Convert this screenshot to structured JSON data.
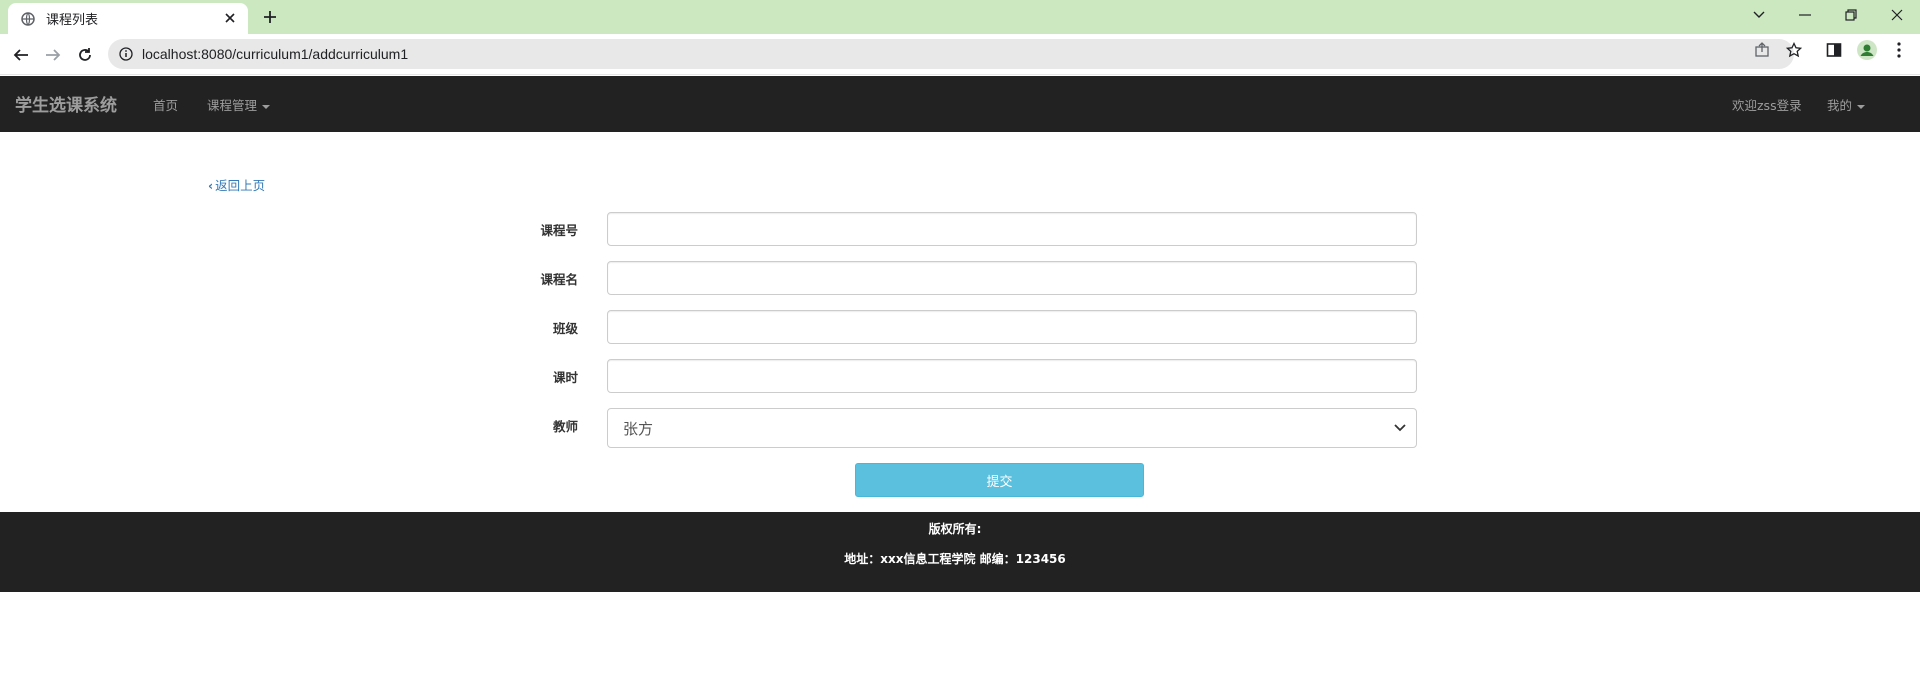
{
  "browser": {
    "tab_title": "课程列表",
    "url": "localhost:8080/curriculum1/addcurriculum1"
  },
  "navbar": {
    "brand": "学生选课系统",
    "home": "首页",
    "course_mgmt": "课程管理",
    "welcome": "欢迎zss登录",
    "mine": "我的"
  },
  "form": {
    "back_link": "返回上页",
    "course_no_label": "课程号",
    "course_no_value": "",
    "course_name_label": "课程名",
    "course_name_value": "",
    "class_label": "班级",
    "class_value": "",
    "hours_label": "课时",
    "hours_value": "",
    "teacher_label": "教师",
    "teacher_selected": "张方",
    "submit_label": "提交"
  },
  "footer": {
    "copyright": "版权所有:",
    "address": "地址：xxx信息工程学院 邮编：123456"
  },
  "colors": {
    "navbar_bg": "#222222",
    "submit_bg": "#5bc0de",
    "link": "#337ab7",
    "tabstrip_bg": "#cce8c0"
  }
}
